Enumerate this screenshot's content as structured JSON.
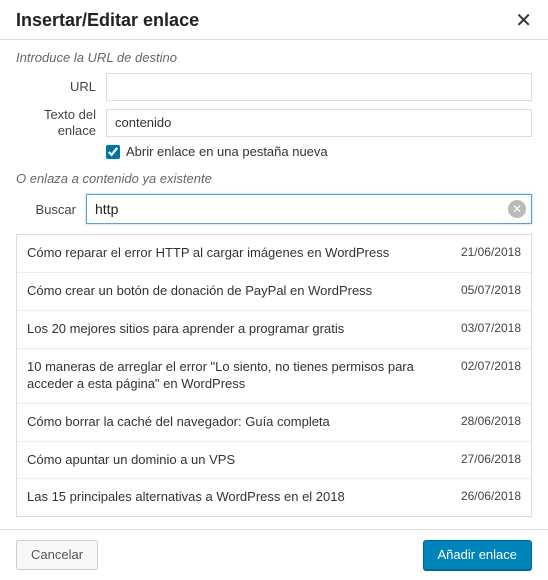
{
  "header": {
    "title": "Insertar/Editar enlace"
  },
  "intro": "Introduce la URL de destino",
  "form": {
    "url_label": "URL",
    "url_value": "",
    "text_label": "Texto del enlace",
    "text_value": "contenido",
    "newtab_label": "Abrir enlace en una pestaña nueva",
    "newtab_checked": true
  },
  "link_section": {
    "heading": "O enlaza a contenido ya existente",
    "search_label": "Buscar",
    "search_value": "http"
  },
  "results": [
    {
      "title": "Cómo reparar el error HTTP al cargar imágenes en WordPress",
      "date": "21/06/2018"
    },
    {
      "title": "Cómo crear un botón de donación de PayPal en WordPress",
      "date": "05/07/2018"
    },
    {
      "title": "Los 20 mejores sitios para aprender a programar gratis",
      "date": "03/07/2018"
    },
    {
      "title": "10 maneras de arreglar el error \"Lo siento, no tienes permisos para acceder a esta página\" en WordPress",
      "date": "02/07/2018"
    },
    {
      "title": "Cómo borrar la caché del navegador: Guía completa",
      "date": "28/06/2018"
    },
    {
      "title": "Cómo apuntar un dominio a un VPS",
      "date": "27/06/2018"
    },
    {
      "title": "Las 15 principales alternativas a WordPress en el 2018",
      "date": "26/06/2018"
    }
  ],
  "footer": {
    "cancel": "Cancelar",
    "submit": "Añadir enlace"
  }
}
